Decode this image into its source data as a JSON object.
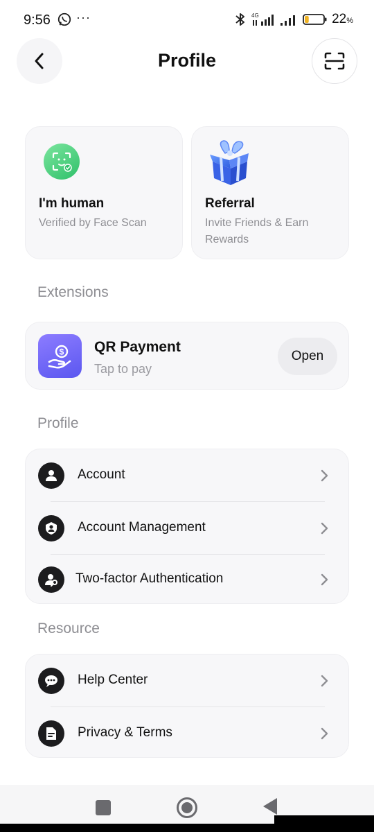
{
  "status_bar": {
    "time": "9:56",
    "dots": "···",
    "network": "4G",
    "battery_percent": "22",
    "battery_suffix": "%",
    "battery_level": 0.22
  },
  "header": {
    "title": "Profile"
  },
  "cards": {
    "human": {
      "title": "I'm human",
      "subtitle": "Verified by Face Scan"
    },
    "referral": {
      "title": "Referral",
      "subtitle": "Invite Friends & Earn Rewards"
    }
  },
  "sections": {
    "extensions": "Extensions",
    "profile": "Profile",
    "resource": "Resource"
  },
  "extension": {
    "title": "QR Payment",
    "subtitle": "Tap to pay",
    "button": "Open"
  },
  "profile_items": [
    {
      "label": "Account",
      "icon": "person-icon"
    },
    {
      "label": "Account Management",
      "icon": "shield-person-icon"
    },
    {
      "label": "Two-factor Authentication",
      "icon": "user-key-icon"
    }
  ],
  "resource_items": [
    {
      "label": "Help Center",
      "icon": "chat-bubble-icon"
    },
    {
      "label": "Privacy & Terms",
      "icon": "document-icon"
    }
  ],
  "colors": {
    "accent_green": "#2fc06a",
    "accent_purple": "#5b57f0",
    "card_bg": "#f7f7f9",
    "muted_text": "#8e8e93"
  }
}
